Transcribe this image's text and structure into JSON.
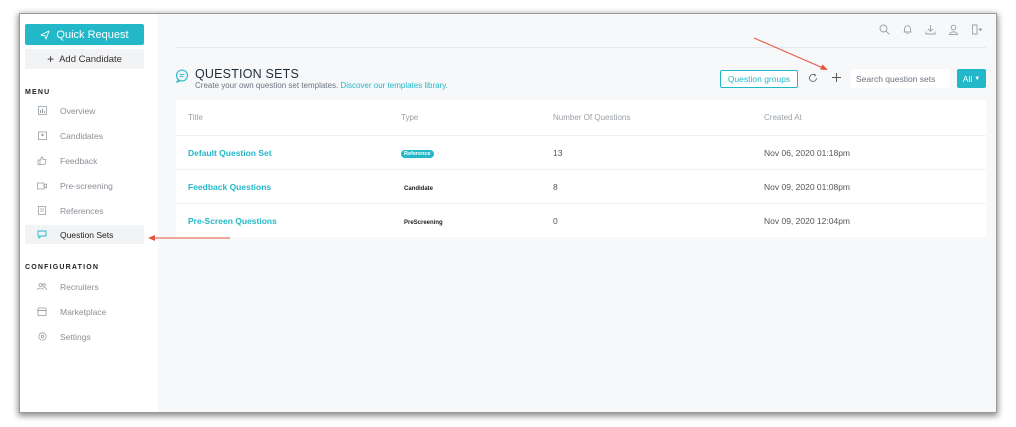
{
  "sidebar": {
    "quick_request": "Quick Request",
    "add_candidate": "Add Candidate",
    "menu_title": "MENU",
    "menu_items": [
      {
        "label": "Overview",
        "icon": "overview-icon"
      },
      {
        "label": "Candidates",
        "icon": "candidates-icon"
      },
      {
        "label": "Feedback",
        "icon": "thumbs-up-icon"
      },
      {
        "label": "Pre-screening",
        "icon": "video-icon"
      },
      {
        "label": "References",
        "icon": "references-icon"
      },
      {
        "label": "Question Sets",
        "icon": "chat-icon",
        "active": true
      }
    ],
    "config_title": "CONFIGURATION",
    "config_items": [
      {
        "label": "Recruiters",
        "icon": "users-icon"
      },
      {
        "label": "Marketplace",
        "icon": "marketplace-icon"
      },
      {
        "label": "Settings",
        "icon": "settings-icon"
      }
    ]
  },
  "header": {
    "title": "QUESTION SETS",
    "subtitle": "Create your own question set templates.",
    "subtitle_link": "Discover our templates library."
  },
  "toolbar": {
    "question_groups": "Question groups",
    "search_placeholder": "Search question sets",
    "filter_label": "All"
  },
  "table": {
    "columns": [
      "Title",
      "Type",
      "Number Of Questions",
      "Created At"
    ],
    "rows": [
      {
        "title": "Default Question Set",
        "type": "Reference",
        "type_badge": true,
        "count": "13",
        "created": "Nov 06, 2020 01:18pm"
      },
      {
        "title": "Feedback Questions",
        "type": "Candidate",
        "type_badge": false,
        "count": "8",
        "created": "Nov 09, 2020 01:08pm"
      },
      {
        "title": "Pre-Screen Questions",
        "type": "PreScreening",
        "type_badge": false,
        "count": "0",
        "created": "Nov 09, 2020 12:04pm"
      }
    ]
  },
  "colors": {
    "accent": "#22b8c9",
    "annotation_arrow": "#e8533a"
  }
}
